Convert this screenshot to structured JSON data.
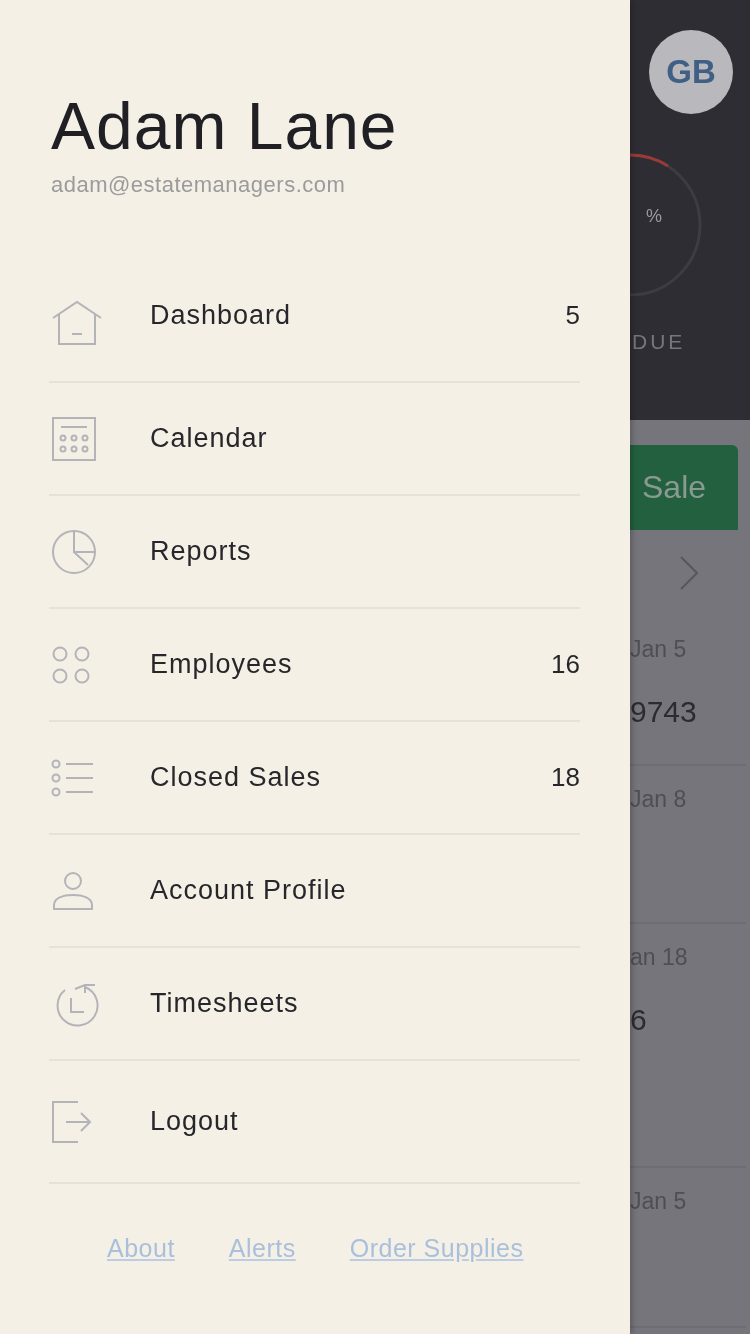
{
  "user": {
    "name": "Adam Lane",
    "email": "adam@estatemanagers.com"
  },
  "menu": [
    {
      "kind": "home",
      "label": "Dashboard",
      "count": "5"
    },
    {
      "kind": "calendar",
      "label": "Calendar"
    },
    {
      "kind": "pie",
      "label": "Reports"
    },
    {
      "kind": "grid",
      "label": "Employees",
      "count": "16"
    },
    {
      "kind": "list",
      "label": "Closed Sales",
      "count": "18"
    },
    {
      "kind": "person",
      "label": "Account Profile"
    },
    {
      "kind": "clock",
      "label": "Timesheets"
    },
    {
      "kind": "logout",
      "label": "Logout"
    }
  ],
  "footer_links": [
    "About",
    "Alerts",
    "Order Supplies"
  ],
  "background": {
    "avatar": "GB",
    "ring_unit": "%",
    "ring_label": "DUE",
    "button": "Sale",
    "entries": [
      {
        "date": "Jan 5",
        "amount": "9743"
      },
      {
        "date": "Jan 8"
      },
      {
        "date": "an 18",
        "amount": "6"
      },
      {
        "date": "Jan 5"
      }
    ]
  }
}
